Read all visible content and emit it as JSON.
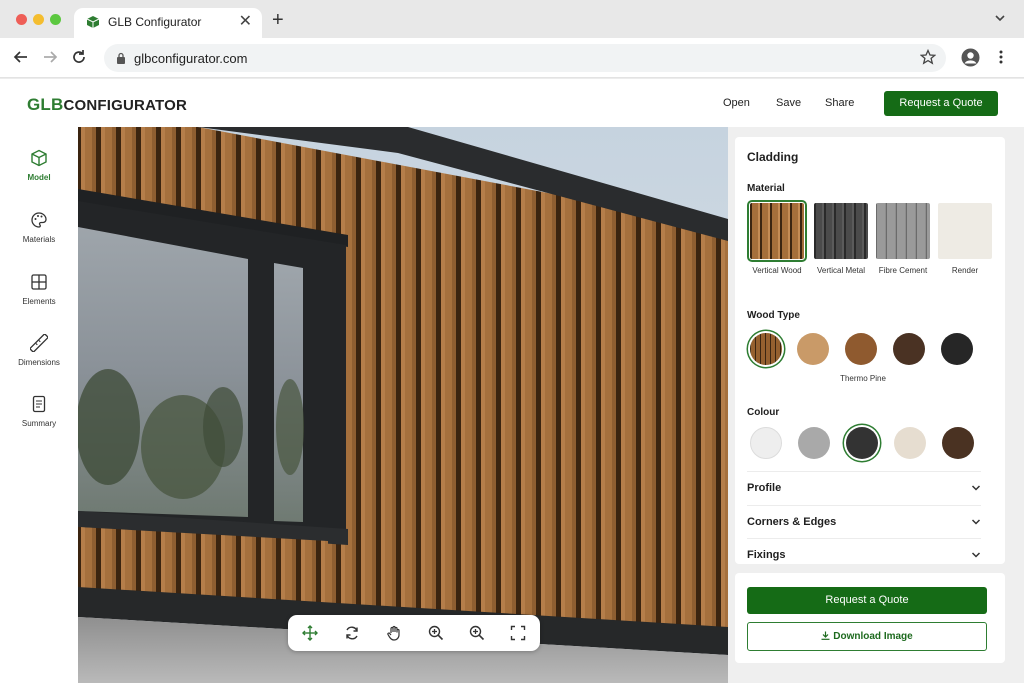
{
  "browser": {
    "tab_title": "GLB Configurator",
    "tab_close": "✕",
    "new_tab": "+",
    "url": "glbconfigurator.com"
  },
  "header": {
    "logo_prefix": "GLB",
    "logo_suffix": "CONFIGURATOR",
    "links": [
      "Open",
      "Save",
      "Share"
    ],
    "cta_label": "Request a Quote"
  },
  "rail": {
    "items": [
      {
        "label": "Model",
        "icon": "cube-icon",
        "active": true
      },
      {
        "label": "Materials",
        "icon": "palette-icon",
        "active": false
      },
      {
        "label": "Elements",
        "icon": "grid-icon",
        "active": false
      },
      {
        "label": "Dimensions",
        "icon": "ruler-icon",
        "active": false
      },
      {
        "label": "Summary",
        "icon": "document-icon",
        "active": false
      }
    ]
  },
  "viewport": {
    "tools": [
      "move-icon",
      "rotate-icon",
      "pan-hand-icon",
      "zoom-in-icon",
      "zoom-out-icon",
      "fullscreen-icon"
    ]
  },
  "panel": {
    "title": "Cladding",
    "material": {
      "label": "Material",
      "options": [
        "Vertical Wood",
        "Vertical Metal",
        "Fibre Cement",
        "Render"
      ],
      "selected": "Vertical Wood"
    },
    "wood_type": {
      "label": "Wood Type",
      "selected_caption": "Thermo Pine",
      "swatch_colors": [
        "#8a5a2e",
        "#c99a68",
        "#8f5a2f",
        "#4a3223",
        "#262626"
      ]
    },
    "colour": {
      "label": "Colour",
      "swatch_colors": [
        "#eeeeee",
        "#a9a9a9",
        "#333333",
        "#e6ddd0",
        "#4a3222"
      ]
    },
    "accordions": [
      "Profile",
      "Corners & Edges",
      "Fixings"
    ],
    "quote_label": "Request a Quote",
    "download_label": "Download Image"
  },
  "colors": {
    "brand_green": "#156b16",
    "accent_green": "#2e7d32"
  }
}
